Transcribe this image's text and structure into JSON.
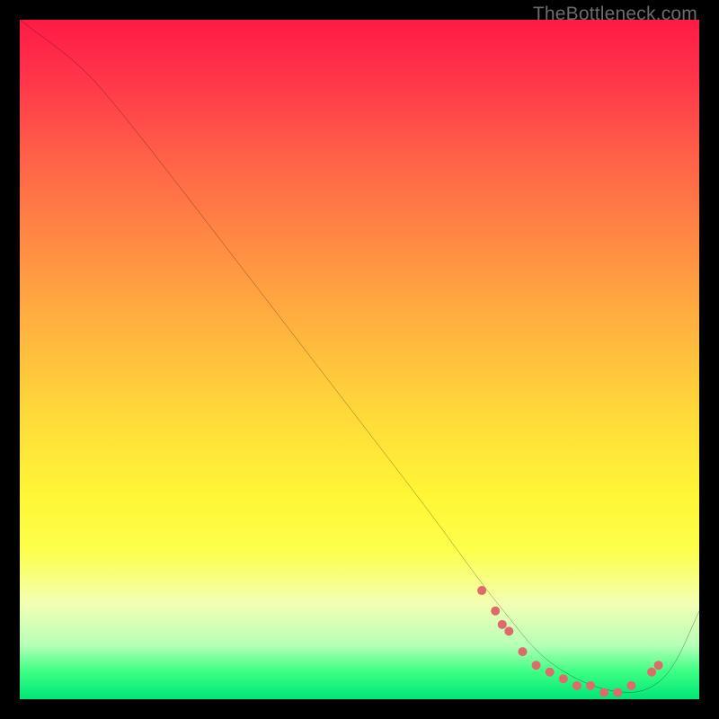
{
  "watermark": "TheBottleneck.com",
  "chart_data": {
    "type": "line",
    "title": "",
    "xlabel": "",
    "ylabel": "",
    "xlim": [
      0,
      100
    ],
    "ylim": [
      0,
      100
    ],
    "background_gradient": {
      "orientation": "vertical",
      "stops": [
        {
          "pos": 0.0,
          "color": "#ff1a46"
        },
        {
          "pos": 0.1,
          "color": "#ff3a4a"
        },
        {
          "pos": 0.2,
          "color": "#ff6048"
        },
        {
          "pos": 0.32,
          "color": "#ff8844"
        },
        {
          "pos": 0.45,
          "color": "#ffb23f"
        },
        {
          "pos": 0.58,
          "color": "#ffd93a"
        },
        {
          "pos": 0.7,
          "color": "#fff636"
        },
        {
          "pos": 0.78,
          "color": "#fdff4a"
        },
        {
          "pos": 0.86,
          "color": "#f2ffb4"
        },
        {
          "pos": 0.92,
          "color": "#b7ffb7"
        },
        {
          "pos": 0.96,
          "color": "#3bff84"
        },
        {
          "pos": 1.0,
          "color": "#00e676"
        }
      ]
    },
    "series": [
      {
        "name": "bottleneck-curve",
        "color": "#000000",
        "x": [
          0,
          4,
          8,
          12,
          20,
          30,
          40,
          50,
          60,
          68,
          72,
          76,
          80,
          84,
          88,
          92,
          96,
          100
        ],
        "y": [
          100,
          97,
          94,
          90,
          80,
          67,
          54,
          41,
          28,
          17,
          12,
          7,
          4,
          2,
          1,
          1,
          4,
          13
        ]
      }
    ],
    "markers": {
      "name": "highlight-points",
      "color": "#e06a6a",
      "radius": 5,
      "points": [
        {
          "x": 68,
          "y": 16
        },
        {
          "x": 70,
          "y": 13
        },
        {
          "x": 71,
          "y": 11
        },
        {
          "x": 72,
          "y": 10
        },
        {
          "x": 74,
          "y": 7
        },
        {
          "x": 76,
          "y": 5
        },
        {
          "x": 78,
          "y": 4
        },
        {
          "x": 80,
          "y": 3
        },
        {
          "x": 82,
          "y": 2
        },
        {
          "x": 84,
          "y": 2
        },
        {
          "x": 86,
          "y": 1
        },
        {
          "x": 88,
          "y": 1
        },
        {
          "x": 90,
          "y": 2
        },
        {
          "x": 93,
          "y": 4
        },
        {
          "x": 94,
          "y": 5
        }
      ]
    }
  }
}
